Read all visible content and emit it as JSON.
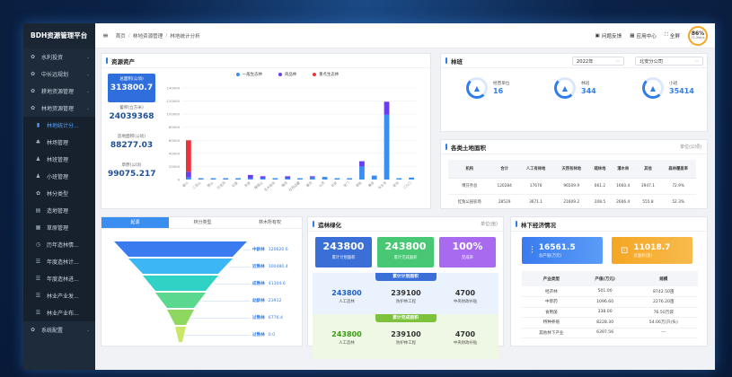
{
  "app": {
    "brand": "BDH资源管理平台"
  },
  "sidebar": {
    "items": [
      {
        "label": "水利投资",
        "icon": "gear-icon",
        "active": false,
        "sub": false
      },
      {
        "label": "中长远规划",
        "icon": "gear-icon",
        "active": false,
        "sub": false
      },
      {
        "label": "耕地资源管理",
        "icon": "gear-icon",
        "active": false,
        "sub": false
      },
      {
        "label": "林地资源管理",
        "icon": "gear-icon",
        "active": false,
        "sub": false
      },
      {
        "label": "林地统计分...",
        "icon": "bar-chart-icon",
        "active": true,
        "sub": true
      },
      {
        "label": "林场管理",
        "icon": "tree-icon",
        "active": false,
        "sub": true
      },
      {
        "label": "林班管理",
        "icon": "user-icon",
        "active": false,
        "sub": true
      },
      {
        "label": "小班管理",
        "icon": "user-icon",
        "active": false,
        "sub": true
      },
      {
        "label": "林分类型",
        "icon": "gear-icon",
        "active": false,
        "sub": true
      },
      {
        "label": "造地管理",
        "icon": "document-icon",
        "active": false,
        "sub": true
      },
      {
        "label": "草原管理",
        "icon": "grid-icon",
        "active": false,
        "sub": true
      },
      {
        "label": "历年造林情...",
        "icon": "clock-icon",
        "active": false,
        "sub": true
      },
      {
        "label": "年度造林计...",
        "icon": "list-icon",
        "active": false,
        "sub": true
      },
      {
        "label": "年度造林进...",
        "icon": "list-icon",
        "active": false,
        "sub": true
      },
      {
        "label": "林业产业发...",
        "icon": "list-icon",
        "active": false,
        "sub": true
      },
      {
        "label": "林业产业布...",
        "icon": "list-icon",
        "active": false,
        "sub": true
      },
      {
        "label": "系统配置",
        "icon": "gear-icon",
        "active": false,
        "sub": false
      }
    ]
  },
  "topbar": {
    "breadcrumb": [
      "首页",
      "林地资源管理",
      "林地统计分析"
    ],
    "feedback": "问题反馈",
    "app_center": "应用中心",
    "fullscreen": "全屏",
    "gauge_value": "86%",
    "gauge_sub": "71.2kb/s"
  },
  "assets": {
    "title": "资源资产",
    "items": [
      {
        "label": "总面积(公顷)",
        "value": "313800.7"
      },
      {
        "label": "蓄积(立方米)",
        "value": "24039368"
      },
      {
        "label": "造地面积(公顷)",
        "value": "88277.03"
      },
      {
        "label": "草原(公顷)",
        "value": "99075.217"
      }
    ]
  },
  "chart_data": {
    "type": "bar",
    "legend": [
      "一般生态林",
      "商品林",
      "重点生态林"
    ],
    "colors": [
      "#3a8ef0",
      "#6a3ef0",
      "#e8353b"
    ],
    "y_ticks": [
      "140000",
      "120000",
      "100000",
      "80000",
      "60000",
      "40000",
      "20000",
      "0"
    ],
    "ylim": [
      0,
      140000
    ],
    "categories": [
      "奋斗",
      "二龙山",
      "尾山",
      "引龙河",
      "红星",
      "友谊",
      "格球山",
      "五大连池",
      "锦河",
      "红色边疆",
      "襄河",
      "山河",
      "北安",
      "龙门",
      "逊克",
      "建设",
      "长水河",
      "赵光",
      "二九〇"
    ],
    "series": [
      {
        "name": "一般生态林",
        "values": [
          3000,
          2000,
          2000,
          2000,
          2000,
          2000,
          2000,
          2000,
          2000,
          2000,
          3000,
          4000,
          2000,
          2000,
          20000,
          6000,
          99000,
          2000,
          3000
        ]
      },
      {
        "name": "商品林",
        "values": [
          9000,
          0,
          0,
          0,
          0,
          5000,
          3000,
          0,
          3000,
          0,
          2000,
          0,
          0,
          0,
          8000,
          0,
          20000,
          0,
          0
        ]
      },
      {
        "name": "重点生态林",
        "values": [
          48000,
          0,
          0,
          0,
          0,
          0,
          0,
          0,
          0,
          0,
          0,
          0,
          0,
          0,
          0,
          0,
          0,
          0,
          0
        ]
      }
    ]
  },
  "forest_class": {
    "title": "林班",
    "year": "2022年",
    "company": "北安分公司",
    "items": [
      {
        "label": "经营单位",
        "value": "16"
      },
      {
        "label": "林班",
        "value": "344"
      },
      {
        "label": "小班",
        "value": "35414"
      }
    ]
  },
  "land_area": {
    "title": "各类土地面积",
    "unit": "单位(公顷)",
    "headers": [
      "机构",
      "合计",
      "人工有林地",
      "天然有林地",
      "疏林地",
      "灌木林",
      "其他",
      "森林覆盖率"
    ],
    "rows": [
      [
        "博芬乔总",
        "120284",
        "17676",
        "96509.9",
        "661.2",
        "1660.4",
        "3947.1",
        "72.9%"
      ],
      [
        "红兔公园农场",
        "28529",
        "3671.1",
        "21609.2",
        "208.5",
        "2606.4",
        "555.8",
        "52.3%"
      ]
    ]
  },
  "funnel": {
    "tabs": [
      "起源",
      "林分类型",
      "林木所有权"
    ],
    "items": [
      {
        "name": "中龄林",
        "value": "120620.6",
        "color": "#3a7bf0"
      },
      {
        "name": "近熟林",
        "value": "100480.4",
        "color": "#3cb6f4"
      },
      {
        "name": "成熟林",
        "value": "41304.6",
        "color": "#2fd2c5"
      },
      {
        "name": "幼龄林",
        "value": "23912",
        "color": "#5bd890"
      },
      {
        "name": "过熟林",
        "value": "6776.4",
        "color": "#8ed860"
      },
      {
        "name": "过熟林",
        "value": "0.0",
        "color": "#c9e86a"
      }
    ]
  },
  "afforest": {
    "title": "造林绿化",
    "unit": "单位(亩)",
    "boxes": [
      {
        "value": "243800",
        "label": "累计计划面积",
        "color": "#3a6fd8"
      },
      {
        "value": "243800",
        "label": "累计完成面积",
        "color": "#48c774"
      },
      {
        "value": "100%",
        "label": "完成率",
        "color": "#a86bf0"
      }
    ],
    "plan1": {
      "title": "累计计划面积",
      "cells": [
        {
          "v": "243800",
          "l": "人工造林"
        },
        {
          "v": "239100",
          "l": "防护林工程"
        },
        {
          "v": "4700",
          "l": "中央财政补贴"
        }
      ]
    },
    "plan2": {
      "title": "累计完成面积",
      "cells": [
        {
          "v": "243800",
          "l": "人工造林"
        },
        {
          "v": "239100",
          "l": "防护林工程"
        },
        {
          "v": "4700",
          "l": "中央财政补贴"
        }
      ]
    }
  },
  "economy": {
    "title": "林下经济情况",
    "box1": {
      "value": "16561.5",
      "label": "总产值(万元)"
    },
    "box2": {
      "value": "11018.7",
      "label": "总面积(亩)"
    },
    "headers": [
      "产业类型",
      "产值(万元)",
      "规模"
    ],
    "rows": [
      [
        "经济林",
        "501.00",
        "8742.50亩"
      ],
      [
        "中草药",
        "1096.60",
        "2276.20亩"
      ],
      [
        "食用菌",
        "338.00",
        "76.50万袋"
      ],
      [
        "特种养殖",
        "8228.30",
        "54.06万(只/头)"
      ],
      [
        "其他林下产业",
        "6397.56",
        "—"
      ]
    ]
  }
}
